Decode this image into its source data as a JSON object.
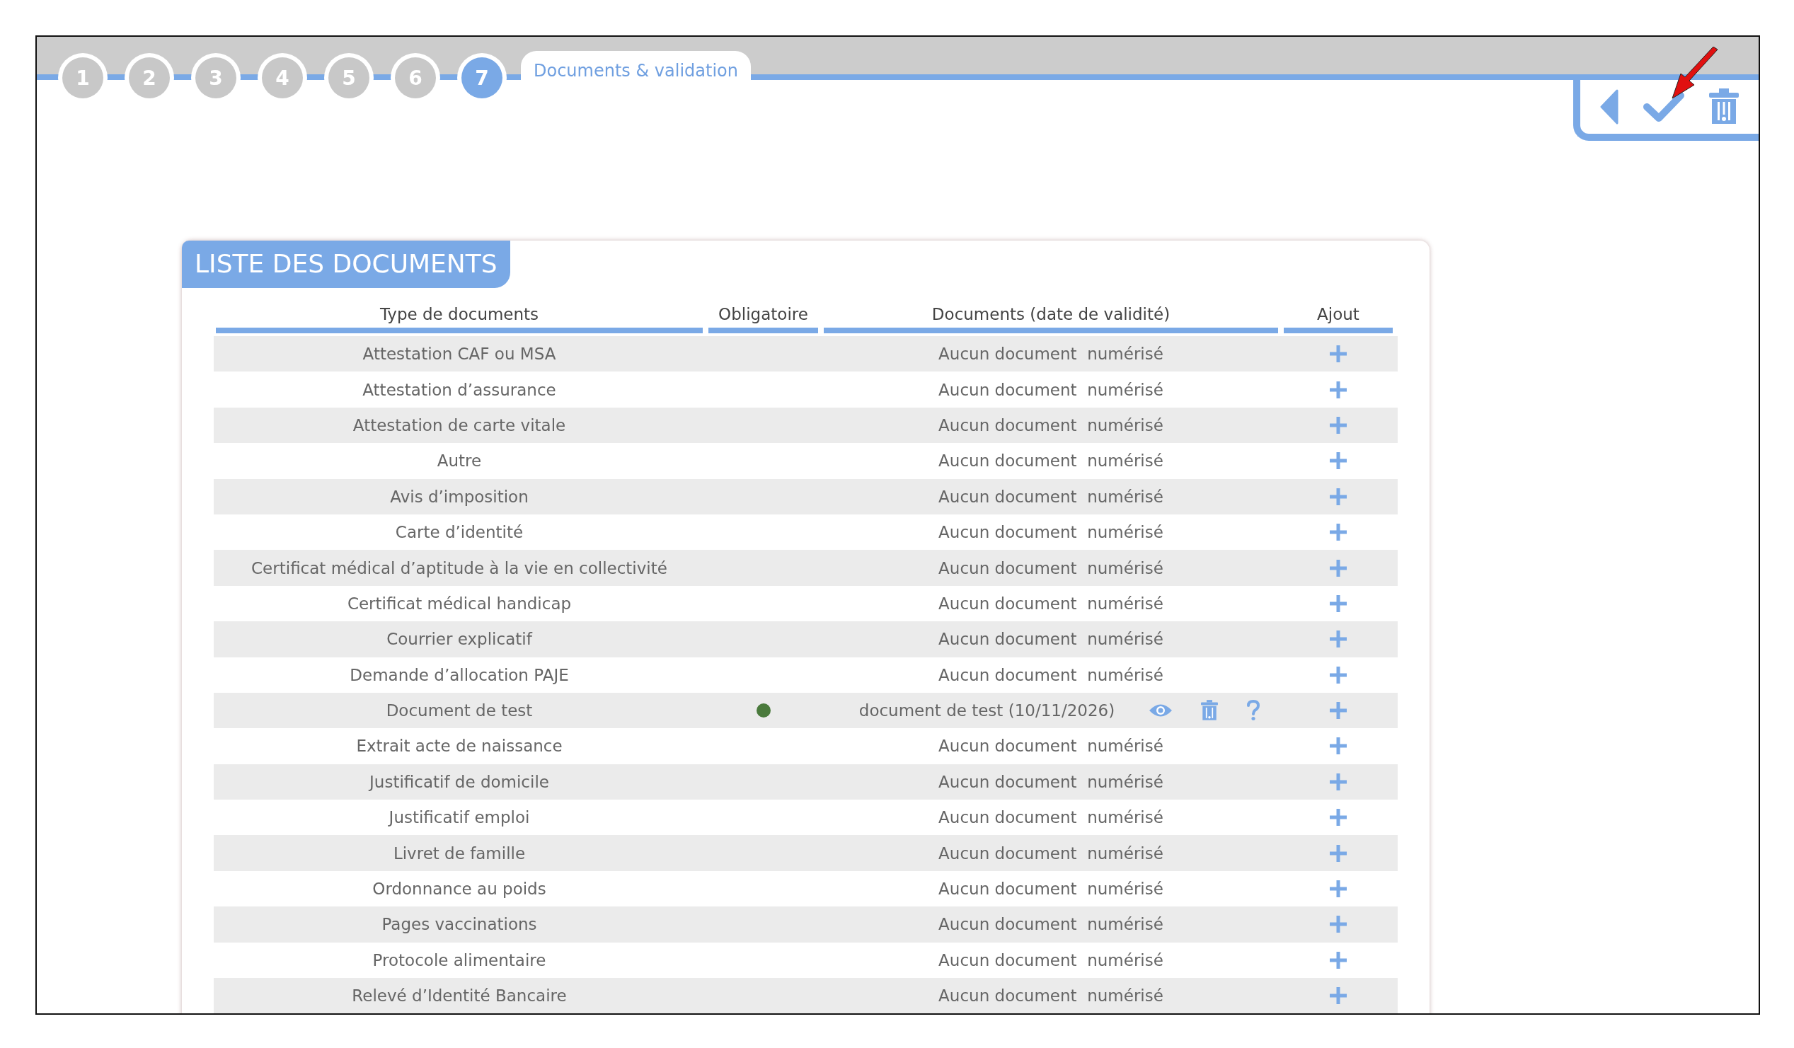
{
  "steps": [
    {
      "label": "1",
      "selected": false
    },
    {
      "label": "2",
      "selected": false
    },
    {
      "label": "3",
      "selected": false
    },
    {
      "label": "4",
      "selected": false
    },
    {
      "label": "5",
      "selected": false
    },
    {
      "label": "6",
      "selected": false
    },
    {
      "label": "7",
      "selected": true
    }
  ],
  "step_title": "Documents & validation",
  "panel": {
    "title": "LISTE DES DOCUMENTS",
    "columns": [
      "Type de documents",
      "Obligatoire",
      "Documents (date de validité)",
      "Ajout"
    ],
    "rows": [
      {
        "kind": "empty",
        "type": "Attestation CAF ou MSA",
        "document": "Aucun document  numérisé"
      },
      {
        "kind": "empty",
        "type": "Attestation d’assurance",
        "document": "Aucun document  numérisé"
      },
      {
        "kind": "empty",
        "type": "Attestation de carte vitale",
        "document": "Aucun document  numérisé"
      },
      {
        "kind": "empty",
        "type": "Autre",
        "document": "Aucun document  numérisé"
      },
      {
        "kind": "empty",
        "type": "Avis d’imposition",
        "document": "Aucun document  numérisé"
      },
      {
        "kind": "empty",
        "type": "Carte d’identité",
        "document": "Aucun document  numérisé"
      },
      {
        "kind": "empty",
        "type": "Certificat médical d’aptitude à la vie en collectivité",
        "document": "Aucun document  numérisé"
      },
      {
        "kind": "empty",
        "type": "Certificat médical handicap",
        "document": "Aucun document  numérisé"
      },
      {
        "kind": "empty",
        "type": "Courrier explicatif",
        "document": "Aucun document  numérisé"
      },
      {
        "kind": "empty",
        "type": "Demande d’allocation PAJE",
        "document": "Aucun document  numérisé"
      },
      {
        "kind": "document",
        "type": "Document de test",
        "color": "#4a7a3c",
        "document": "document de test (10/11/2026)"
      },
      {
        "kind": "empty",
        "type": "Extrait acte de naissance",
        "document": "Aucun document  numérisé"
      },
      {
        "kind": "empty",
        "type": "Justificatif de domicile",
        "document": "Aucun document  numérisé"
      },
      {
        "kind": "empty",
        "type": "Justificatif emploi",
        "document": "Aucun document  numérisé"
      },
      {
        "kind": "empty",
        "type": "Livret de famille",
        "document": "Aucun document  numérisé"
      },
      {
        "kind": "empty",
        "type": "Ordonnance au poids",
        "document": "Aucun document  numérisé"
      },
      {
        "kind": "empty",
        "type": "Pages vaccinations",
        "document": "Aucun document  numérisé"
      },
      {
        "kind": "empty",
        "type": "Protocole alimentaire",
        "document": "Aucun document  numérisé"
      },
      {
        "kind": "empty",
        "type": "Relevé d’Identité Bancaire",
        "document": "Aucun document  numérisé"
      }
    ]
  }
}
